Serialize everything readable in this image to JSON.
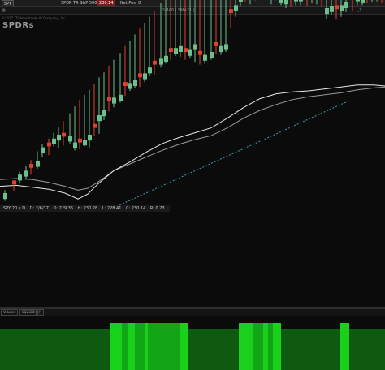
{
  "toolbar": {
    "symbol": "SPY",
    "description": "SPDR TR S&P 500 ETF TR",
    "last": "230.14",
    "position": "Net Pos: 0",
    "study_text": "SMA8 | SMA21 | ..."
  },
  "watermark": "©2017 TD Ameritrade IP Company, Inc.",
  "logo_text": "SPDRs",
  "chart_header": {
    "symbol_period": "SPY 20 y D",
    "date": "D: 2/6/17",
    "open": "O: 229.36",
    "high": "H: 230.28",
    "low": "L: 228.41",
    "close": "C: 230.14",
    "change": "R: 0.23"
  },
  "volume_header": {
    "label": "Volume",
    "study": "SQZ(20)",
    "flag": "Ⓕ"
  },
  "colors": {
    "up": "#6bbf8c",
    "down": "#e0402e",
    "sma_fast": "#e8e8e8",
    "sma_slow": "#9a9a9a",
    "trend": "#3d9bb5",
    "vol_bright": "#19d11a",
    "vol_mid": "#12a515",
    "vol_dark": "#0d5a10"
  },
  "chart_data": {
    "type": "candlestick",
    "series": [
      {
        "name": "price",
        "ohlc": [
          [
            4,
            5,
            6,
            3
          ],
          [
            15,
            14,
            16,
            13
          ],
          [
            22,
            24,
            25,
            21
          ],
          [
            30,
            28,
            31,
            26
          ],
          [
            36,
            31,
            37,
            30
          ],
          [
            44,
            38,
            46,
            36
          ],
          [
            50,
            52,
            53,
            48
          ],
          [
            58,
            53,
            59,
            50
          ],
          [
            64,
            61,
            65,
            59
          ],
          [
            70,
            65,
            71,
            57
          ],
          [
            76,
            63,
            77,
            60
          ],
          [
            84,
            64,
            85,
            62
          ],
          [
            90,
            57,
            92,
            55
          ],
          [
            96,
            57,
            99,
            56
          ],
          [
            102,
            60,
            104,
            59
          ],
          [
            108,
            65,
            109,
            58
          ],
          [
            114,
            72,
            115,
            70
          ],
          [
            120,
            85,
            122,
            72
          ],
          [
            126,
            90,
            127,
            86
          ],
          [
            132,
            100,
            134,
            95
          ],
          [
            138,
            103,
            140,
            99
          ],
          [
            146,
            106,
            147,
            104
          ],
          [
            152,
            115,
            154,
            111
          ],
          [
            158,
            118,
            159,
            116
          ],
          [
            164,
            121,
            166,
            119
          ],
          [
            170,
            124,
            172,
            120
          ],
          [
            176,
            128,
            178,
            125
          ],
          [
            182,
            134,
            184,
            131
          ],
          [
            188,
            137,
            190,
            132
          ],
          [
            196,
            143,
            198,
            140
          ],
          [
            202,
            146,
            203,
            144
          ],
          [
            208,
            150,
            210,
            148
          ],
          [
            214,
            154,
            216,
            152
          ],
          [
            220,
            156,
            222,
            151
          ],
          [
            226,
            150,
            228,
            148
          ],
          [
            232,
            152,
            234,
            150
          ],
          [
            238,
            158,
            240,
            145
          ],
          [
            244,
            147,
            246,
            143
          ],
          [
            250,
            147,
            252,
            144
          ],
          [
            258,
            150,
            260,
            148
          ],
          [
            264,
            156,
            266,
            154
          ],
          [
            270,
            156,
            272,
            153
          ],
          [
            276,
            158,
            278,
            156
          ],
          [
            282,
            190,
            284,
            180
          ],
          [
            288,
            198,
            290,
            192
          ],
          [
            294,
            207,
            296,
            203
          ],
          [
            300,
            212,
            302,
            208
          ],
          [
            306,
            210,
            308,
            205
          ],
          [
            312,
            216,
            314,
            209
          ],
          [
            318,
            222,
            320,
            216
          ],
          [
            324,
            220,
            326,
            210
          ],
          [
            332,
            210,
            334,
            205
          ],
          [
            338,
            213,
            340,
            209
          ],
          [
            344,
            206,
            346,
            204
          ],
          [
            350,
            205,
            352,
            201
          ],
          [
            356,
            209,
            358,
            202
          ],
          [
            362,
            208,
            364,
            204
          ],
          [
            368,
            208,
            370,
            204
          ],
          [
            376,
            206,
            378,
            203
          ],
          [
            382,
            212,
            384,
            206
          ],
          [
            388,
            210,
            390,
            205
          ],
          [
            394,
            205,
            396,
            202
          ],
          [
            400,
            195,
            402,
            190
          ],
          [
            406,
            197,
            408,
            194
          ],
          [
            412,
            194,
            414,
            189
          ],
          [
            418,
            198,
            420,
            192
          ],
          [
            424,
            201,
            426,
            197
          ],
          [
            432,
            206,
            434,
            198
          ],
          [
            438,
            208,
            440,
            204
          ],
          [
            444,
            206,
            446,
            204
          ],
          [
            450,
            213,
            452,
            206
          ],
          [
            456,
            211,
            458,
            207
          ],
          [
            462,
            210,
            464,
            208
          ],
          [
            468,
            207,
            470,
            206
          ]
        ]
      }
    ],
    "sma_fast": [
      [
        0,
        12
      ],
      [
        20,
        13
      ],
      [
        40,
        11
      ],
      [
        60,
        9
      ],
      [
        80,
        5
      ],
      [
        96,
        -1
      ],
      [
        108,
        4
      ],
      [
        120,
        14
      ],
      [
        140,
        28
      ],
      [
        160,
        37
      ],
      [
        180,
        47
      ],
      [
        200,
        56
      ],
      [
        220,
        62
      ],
      [
        240,
        67
      ],
      [
        260,
        72
      ],
      [
        280,
        82
      ],
      [
        300,
        93
      ],
      [
        320,
        102
      ],
      [
        340,
        107
      ],
      [
        360,
        109
      ],
      [
        380,
        110
      ],
      [
        400,
        112
      ],
      [
        420,
        114
      ],
      [
        440,
        116
      ],
      [
        460,
        116
      ],
      [
        474,
        115
      ]
    ],
    "sma_slow": [
      [
        0,
        19
      ],
      [
        20,
        20
      ],
      [
        40,
        19
      ],
      [
        60,
        16
      ],
      [
        80,
        12
      ],
      [
        96,
        8
      ],
      [
        108,
        10
      ],
      [
        120,
        16
      ],
      [
        140,
        28
      ],
      [
        160,
        35
      ],
      [
        180,
        42
      ],
      [
        200,
        49
      ],
      [
        220,
        55
      ],
      [
        240,
        60
      ],
      [
        260,
        64
      ],
      [
        280,
        72
      ],
      [
        300,
        82
      ],
      [
        320,
        90
      ],
      [
        340,
        96
      ],
      [
        360,
        101
      ],
      [
        380,
        104
      ],
      [
        400,
        106
      ],
      [
        420,
        108
      ],
      [
        440,
        111
      ],
      [
        460,
        113
      ],
      [
        474,
        114
      ]
    ],
    "trend_line": [
      [
        100,
        0
      ],
      [
        430,
        100
      ]
    ],
    "volume_levels": [
      [
        "dark",
        0,
        135
      ],
      [
        "bright",
        135,
        150
      ],
      [
        "mid",
        150,
        158
      ],
      [
        "bright",
        158,
        166
      ],
      [
        "mid",
        166,
        178
      ],
      [
        "bright",
        178,
        182
      ],
      [
        "mid",
        182,
        222
      ],
      [
        "bright",
        222,
        232
      ],
      [
        "dark",
        232,
        294
      ],
      [
        "bright",
        294,
        312
      ],
      [
        "mid",
        312,
        324
      ],
      [
        "bright",
        324,
        330
      ],
      [
        "mid",
        330,
        336
      ],
      [
        "bright",
        336,
        346
      ],
      [
        "dark",
        346,
        418
      ],
      [
        "bright",
        418,
        430
      ],
      [
        "dark",
        430,
        474
      ]
    ]
  }
}
